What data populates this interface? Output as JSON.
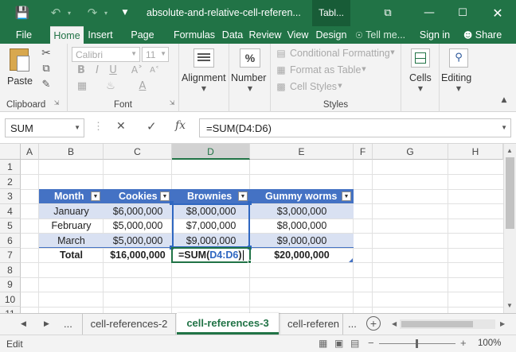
{
  "title": {
    "filename": "absolute-and-relative-cell-referen...",
    "context_tab": "Tabl..."
  },
  "tabs": [
    "File",
    "Home",
    "Insert",
    "Page Layou",
    "Formulas",
    "Data",
    "Review",
    "View",
    "Design"
  ],
  "tell_me": "Tell me...",
  "sign_in": "Sign in",
  "share": "Share",
  "ribbon": {
    "clipboard": {
      "label": "Clipboard",
      "paste": "Paste"
    },
    "font": {
      "label": "Font",
      "name": "Calibri",
      "size": "11"
    },
    "alignment": "Alignment",
    "number": "Number",
    "styles": {
      "label": "Styles",
      "conditional": "Conditional Formatting",
      "format_table": "Format as Table",
      "cell_styles": "Cell Styles"
    },
    "cells": "Cells",
    "editing": "Editing"
  },
  "formula_bar": {
    "name_box": "SUM",
    "formula": "=SUM(D4:D6)"
  },
  "columns": [
    "A",
    "B",
    "C",
    "D",
    "E",
    "F",
    "G",
    "H"
  ],
  "rows": [
    "1",
    "2",
    "3",
    "4",
    "5",
    "6",
    "7",
    "8",
    "9",
    "10",
    "11"
  ],
  "table": {
    "headers": [
      "Month",
      "Cookies",
      "Brownies",
      "Gummy worms"
    ],
    "rows": [
      [
        "January",
        "$6,000,000",
        "$8,000,000",
        "$3,000,000"
      ],
      [
        "February",
        "$5,000,000",
        "$7,000,000",
        "$8,000,000"
      ],
      [
        "March",
        "$5,000,000",
        "$9,000,000",
        "$9,000,000"
      ]
    ],
    "total_label": "Total",
    "total_cookies": "$16,000,000",
    "total_formula_prefix": "=SUM(",
    "total_formula_ref": "D4:D6",
    "total_formula_suffix": ")",
    "total_gummy": "$20,000,000"
  },
  "sheets": {
    "ellipsis": "...",
    "prev": "cell-references-2",
    "active": "cell-references-3",
    "next": "cell-referen"
  },
  "status": {
    "mode": "Edit",
    "zoom": "100%"
  },
  "colors": {
    "accent": "#217346",
    "table_header": "#4472c4",
    "band": "#d9e1f2"
  },
  "icons": [
    "save-icon",
    "undo-icon",
    "redo-icon",
    "customize-icon",
    "restore-icon",
    "minimize-icon",
    "maximize-icon",
    "close-icon",
    "bulb-icon",
    "share-icon",
    "paste-icon",
    "cut-icon",
    "copy-icon",
    "format-painter-icon",
    "bold-icon",
    "italic-icon",
    "underline-icon",
    "borders-icon",
    "fill-color-icon",
    "font-color-icon",
    "alignment-icon",
    "percent-icon",
    "conditional-icon",
    "format-table-icon",
    "cell-styles-icon",
    "cells-icon",
    "search-icon",
    "cancel-icon",
    "enter-icon",
    "fx-icon",
    "add-sheet-icon"
  ]
}
